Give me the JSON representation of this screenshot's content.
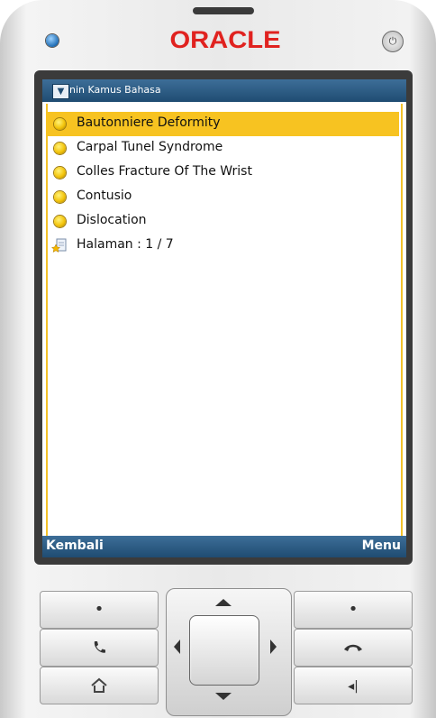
{
  "phone": {
    "brand": "ORACLE",
    "power_glyph": "⏻"
  },
  "screen": {
    "title": "nin Kamus Bahasa",
    "toggle_glyph": "▼",
    "list": [
      {
        "label": "Bautonniere Deformity",
        "selected": true
      },
      {
        "label": "Carpal Tunel Syndrome",
        "selected": false
      },
      {
        "label": "Colles Fracture Of The Wrist",
        "selected": false
      },
      {
        "label": "Contusio",
        "selected": false
      },
      {
        "label": "Dislocation",
        "selected": false
      }
    ],
    "page_label": "Halaman : 1 / 7",
    "softkeys": {
      "left": "Kembali",
      "right": "Menu"
    }
  },
  "keypad": {
    "left_top_glyph": "•",
    "right_top_glyph": "•",
    "call_glyph": "📞",
    "end_call_glyph": "☎",
    "home_glyph": "⌂",
    "back_glyph": "◂|"
  },
  "colors": {
    "brand_red": "#e0221f",
    "titlebar_blue": "#2a5a82",
    "selection_yellow": "#f7c321"
  }
}
